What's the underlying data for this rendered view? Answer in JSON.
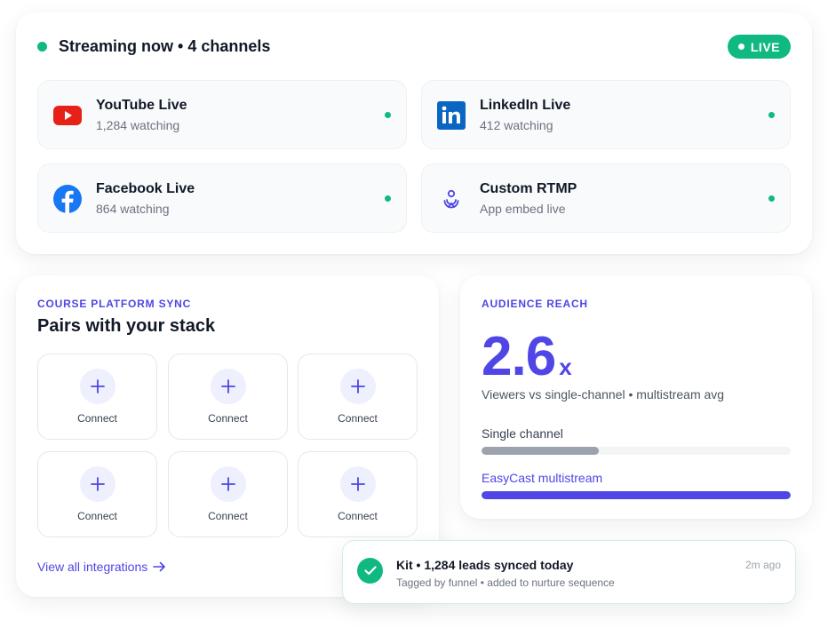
{
  "streaming": {
    "title": "Streaming now • 4 channels",
    "live_label": "LIVE",
    "channels": [
      {
        "name": "YouTube Live",
        "sub": "1,284 watching",
        "icon": "youtube-icon"
      },
      {
        "name": "LinkedIn Live",
        "sub": "412 watching",
        "icon": "linkedin-icon"
      },
      {
        "name": "Facebook Live",
        "sub": "864 watching",
        "icon": "facebook-icon"
      },
      {
        "name": "Custom RTMP",
        "sub": "App embed live",
        "icon": "rtmp-icon"
      }
    ]
  },
  "course": {
    "eyebrow": "COURSE PLATFORM SYNC",
    "title": "Pairs with your stack",
    "tiles": [
      {
        "label": "Connect"
      },
      {
        "label": "Connect"
      },
      {
        "label": "Connect"
      },
      {
        "label": "Connect"
      },
      {
        "label": "Connect"
      },
      {
        "label": "Connect"
      }
    ],
    "view_all": "View all integrations"
  },
  "audience": {
    "eyebrow": "AUDIENCE REACH",
    "value": "2.6",
    "suffix": "x",
    "description": "Viewers vs single-channel • multistream avg",
    "bars": [
      {
        "label": "Single channel",
        "fraction": 0.38,
        "color": "#9ca3af",
        "label_color": "#374151"
      },
      {
        "label": "EasyCast multistream",
        "fraction": 1.0,
        "color": "#4f46e5",
        "label_color": "#4f46e5"
      }
    ]
  },
  "toast": {
    "title": "Kit • 1,284 leads synced today",
    "subtitle": "Tagged by funnel • added to nurture sequence",
    "time": "2m ago"
  },
  "colors": {
    "accent": "#4f46e5",
    "live_green": "#10b981",
    "youtube_red": "#ff0000",
    "linkedin_blue": "#0a66c2",
    "facebook_blue": "#1877f2"
  }
}
